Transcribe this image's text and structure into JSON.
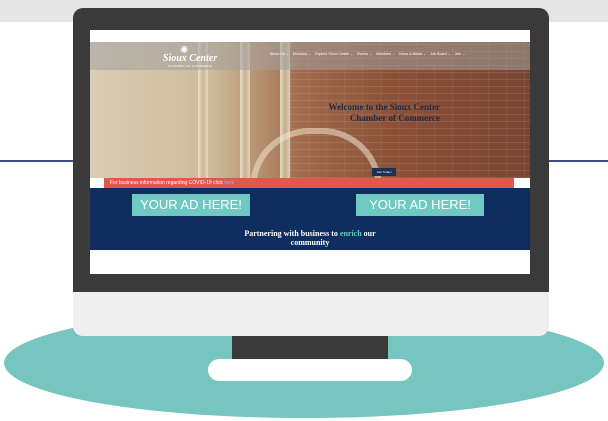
{
  "colors": {
    "navy": "#0f2e60",
    "teal": "#76c5bf",
    "alert_red": "#e3564c",
    "bezel": "#3a3a3a"
  },
  "logo": {
    "title": "Sioux Center",
    "subtitle": "CHAMBER OF COMMERCE",
    "icon": "sunburst-logo-icon"
  },
  "nav": {
    "items": [
      "About Us ⌄",
      "Directory ⌄",
      "Explore Sioux Center ⌄",
      "Events ⌄",
      "Members ⌄",
      "News & Media ⌄",
      "Job Board ⌄",
      "Join ⌄"
    ]
  },
  "hero": {
    "welcome_prefix": "Welcome to the ",
    "welcome_highlight": "Sioux Center",
    "welcome_line2": "Chamber of Commerce",
    "join_label": "Join Today!"
  },
  "alert": {
    "text": "For business information regarding COVID-19 click ",
    "link": "here"
  },
  "ads": {
    "left": "YOUR AD HERE!",
    "right": "YOUR AD HERE!"
  },
  "tagline": {
    "prefix": "Partnering with business to ",
    "accent": "enrich",
    "suffix": " our",
    "line2": "community"
  }
}
